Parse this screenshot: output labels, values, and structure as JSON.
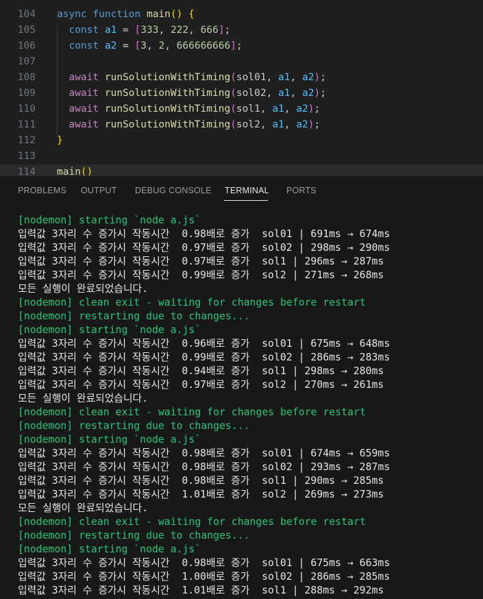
{
  "editor": {
    "lines": [
      {
        "num": "104",
        "tokens": [
          {
            "t": "async ",
            "c": "kw"
          },
          {
            "t": "function ",
            "c": "kw"
          },
          {
            "t": "main",
            "c": "fn"
          },
          {
            "t": "() ",
            "c": "br1"
          },
          {
            "t": "{",
            "c": "br1"
          }
        ]
      },
      {
        "num": "105",
        "tokens": [
          {
            "t": "  ",
            "c": "pun"
          },
          {
            "t": "const ",
            "c": "kw"
          },
          {
            "t": "a1",
            "c": "var"
          },
          {
            "t": " = ",
            "c": "pun"
          },
          {
            "t": "[",
            "c": "br2"
          },
          {
            "t": "333",
            "c": "num"
          },
          {
            "t": ", ",
            "c": "pun"
          },
          {
            "t": "222",
            "c": "num"
          },
          {
            "t": ", ",
            "c": "pun"
          },
          {
            "t": "666",
            "c": "num"
          },
          {
            "t": "]",
            "c": "br2"
          },
          {
            "t": ";",
            "c": "pun"
          }
        ]
      },
      {
        "num": "106",
        "tokens": [
          {
            "t": "  ",
            "c": "pun"
          },
          {
            "t": "const ",
            "c": "kw"
          },
          {
            "t": "a2",
            "c": "var"
          },
          {
            "t": " = ",
            "c": "pun"
          },
          {
            "t": "[",
            "c": "br2"
          },
          {
            "t": "3",
            "c": "num"
          },
          {
            "t": ", ",
            "c": "pun"
          },
          {
            "t": "2",
            "c": "num"
          },
          {
            "t": ", ",
            "c": "pun"
          },
          {
            "t": "666666666",
            "c": "num"
          },
          {
            "t": "]",
            "c": "br2"
          },
          {
            "t": ";",
            "c": "pun"
          }
        ]
      },
      {
        "num": "107",
        "tokens": []
      },
      {
        "num": "108",
        "tokens": [
          {
            "t": "  ",
            "c": "pun"
          },
          {
            "t": "await ",
            "c": "kw2"
          },
          {
            "t": "runSolutionWithTiming",
            "c": "fn"
          },
          {
            "t": "(",
            "c": "br2"
          },
          {
            "t": "sol01",
            "c": "pun"
          },
          {
            "t": ", ",
            "c": "pun"
          },
          {
            "t": "a1",
            "c": "var"
          },
          {
            "t": ", ",
            "c": "pun"
          },
          {
            "t": "a2",
            "c": "var"
          },
          {
            "t": ")",
            "c": "br2"
          },
          {
            "t": ";",
            "c": "pun"
          }
        ]
      },
      {
        "num": "109",
        "tokens": [
          {
            "t": "  ",
            "c": "pun"
          },
          {
            "t": "await ",
            "c": "kw2"
          },
          {
            "t": "runSolutionWithTiming",
            "c": "fn"
          },
          {
            "t": "(",
            "c": "br2"
          },
          {
            "t": "sol02",
            "c": "pun"
          },
          {
            "t": ", ",
            "c": "pun"
          },
          {
            "t": "a1",
            "c": "var"
          },
          {
            "t": ", ",
            "c": "pun"
          },
          {
            "t": "a2",
            "c": "var"
          },
          {
            "t": ")",
            "c": "br2"
          },
          {
            "t": ";",
            "c": "pun"
          }
        ]
      },
      {
        "num": "110",
        "tokens": [
          {
            "t": "  ",
            "c": "pun"
          },
          {
            "t": "await ",
            "c": "kw2"
          },
          {
            "t": "runSolutionWithTiming",
            "c": "fn"
          },
          {
            "t": "(",
            "c": "br2"
          },
          {
            "t": "sol1",
            "c": "pun"
          },
          {
            "t": ", ",
            "c": "pun"
          },
          {
            "t": "a1",
            "c": "var"
          },
          {
            "t": ", ",
            "c": "pun"
          },
          {
            "t": "a2",
            "c": "var"
          },
          {
            "t": ")",
            "c": "br2"
          },
          {
            "t": ";",
            "c": "pun"
          }
        ]
      },
      {
        "num": "111",
        "tokens": [
          {
            "t": "  ",
            "c": "pun"
          },
          {
            "t": "await ",
            "c": "kw2"
          },
          {
            "t": "runSolutionWithTiming",
            "c": "fn"
          },
          {
            "t": "(",
            "c": "br2"
          },
          {
            "t": "sol2",
            "c": "pun"
          },
          {
            "t": ", ",
            "c": "pun"
          },
          {
            "t": "a1",
            "c": "var"
          },
          {
            "t": ", ",
            "c": "pun"
          },
          {
            "t": "a2",
            "c": "var"
          },
          {
            "t": ")",
            "c": "br2"
          },
          {
            "t": ";",
            "c": "pun"
          }
        ]
      },
      {
        "num": "112",
        "tokens": [
          {
            "t": "}",
            "c": "br1"
          }
        ]
      },
      {
        "num": "113",
        "tokens": []
      },
      {
        "num": "114",
        "tokens": [
          {
            "t": "main",
            "c": "fn"
          },
          {
            "t": "()",
            "c": "br1"
          }
        ]
      }
    ]
  },
  "panel": {
    "tabs": [
      {
        "label": "PROBLEMS",
        "active": false
      },
      {
        "label": "OUTPUT",
        "active": false
      },
      {
        "label": "DEBUG CONSOLE",
        "active": false
      },
      {
        "label": "TERMINAL",
        "active": true
      },
      {
        "label": "PORTS",
        "active": false
      }
    ]
  },
  "terminal": {
    "lines": [
      {
        "text": "[nodemon] starting `node a.js`",
        "style": "green"
      },
      {
        "text": "입력값 3자리 수 증가시 작동시간  0.98배로 증가  sol01 | 691ms → 674ms",
        "style": "normal"
      },
      {
        "text": "입력값 3자리 수 증가시 작동시간  0.97배로 증가  sol02 | 298ms → 290ms",
        "style": "normal"
      },
      {
        "text": "입력값 3자리 수 증가시 작동시간  0.97배로 증가  sol1 | 296ms → 287ms",
        "style": "normal"
      },
      {
        "text": "입력값 3자리 수 증가시 작동시간  0.99배로 증가  sol2 | 271ms → 268ms",
        "style": "normal"
      },
      {
        "text": "모든 실행이 완료되었습니다.",
        "style": "normal"
      },
      {
        "text": "[nodemon] clean exit - waiting for changes before restart",
        "style": "green"
      },
      {
        "text": "[nodemon] restarting due to changes...",
        "style": "green"
      },
      {
        "text": "[nodemon] starting `node a.js`",
        "style": "green"
      },
      {
        "text": "입력값 3자리 수 증가시 작동시간  0.96배로 증가  sol01 | 675ms → 648ms",
        "style": "normal"
      },
      {
        "text": "입력값 3자리 수 증가시 작동시간  0.99배로 증가  sol02 | 286ms → 283ms",
        "style": "normal"
      },
      {
        "text": "입력값 3자리 수 증가시 작동시간  0.94배로 증가  sol1 | 298ms → 280ms",
        "style": "normal"
      },
      {
        "text": "입력값 3자리 수 증가시 작동시간  0.97배로 증가  sol2 | 270ms → 261ms",
        "style": "normal"
      },
      {
        "text": "모든 실행이 완료되었습니다.",
        "style": "normal"
      },
      {
        "text": "[nodemon] clean exit - waiting for changes before restart",
        "style": "green"
      },
      {
        "text": "[nodemon] restarting due to changes...",
        "style": "green"
      },
      {
        "text": "[nodemon] starting `node a.js`",
        "style": "green"
      },
      {
        "text": "입력값 3자리 수 증가시 작동시간  0.98배로 증가  sol01 | 674ms → 659ms",
        "style": "normal"
      },
      {
        "text": "입력값 3자리 수 증가시 작동시간  0.98배로 증가  sol02 | 293ms → 287ms",
        "style": "normal"
      },
      {
        "text": "입력값 3자리 수 증가시 작동시간  0.98배로 증가  sol1 | 290ms → 285ms",
        "style": "normal"
      },
      {
        "text": "입력값 3자리 수 증가시 작동시간  1.01배로 증가  sol2 | 269ms → 273ms",
        "style": "normal"
      },
      {
        "text": "모든 실행이 완료되었습니다.",
        "style": "normal"
      },
      {
        "text": "[nodemon] clean exit - waiting for changes before restart",
        "style": "green"
      },
      {
        "text": "[nodemon] restarting due to changes...",
        "style": "green"
      },
      {
        "text": "[nodemon] starting `node a.js`",
        "style": "green"
      },
      {
        "text": "입력값 3자리 수 증가시 작동시간  0.98배로 증가  sol01 | 675ms → 663ms",
        "style": "normal"
      },
      {
        "text": "입력값 3자리 수 증가시 작동시간  1.00배로 증가  sol02 | 286ms → 285ms",
        "style": "normal"
      },
      {
        "text": "입력값 3자리 수 증가시 작동시간  1.01배로 증가  sol1 | 288ms → 292ms",
        "style": "normal"
      }
    ]
  },
  "colors": {
    "editor_bg": "#1f1f1f",
    "terminal_bg": "#181818",
    "nodemon_green": "#23c77c",
    "terminal_text": "#e6e6e6"
  }
}
